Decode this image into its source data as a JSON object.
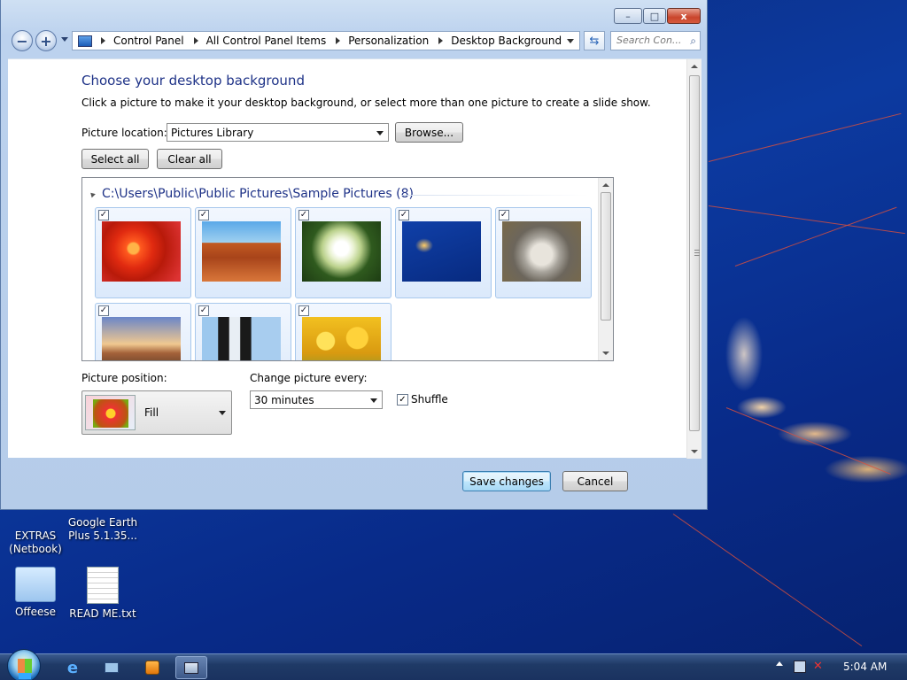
{
  "window": {
    "caption": {
      "minimize": "–",
      "maximize": "□",
      "close": "x"
    },
    "address": {
      "crumbs": [
        "Control Panel",
        "All Control Panel Items",
        "Personalization",
        "Desktop Background"
      ]
    },
    "search_placeholder": "Search Con...",
    "content": {
      "title": "Choose your desktop background",
      "subtitle": "Click a picture to make it your desktop background, or select more than one picture to create a slide show.",
      "picture_location_label": "Picture location:",
      "picture_location_value": "Pictures Library",
      "browse_label": "Browse...",
      "select_all_label": "Select all",
      "clear_all_label": "Clear all",
      "group_header": "C:\\Users\\Public\\Public Pictures\\Sample Pictures (8)",
      "pictures": [
        {
          "name": "chrysanthemum",
          "checked": true
        },
        {
          "name": "desert",
          "checked": true
        },
        {
          "name": "hydrangeas",
          "checked": true
        },
        {
          "name": "jellyfish",
          "checked": true
        },
        {
          "name": "koala",
          "checked": true
        },
        {
          "name": "lighthouse",
          "checked": true
        },
        {
          "name": "penguins",
          "checked": true
        },
        {
          "name": "tulips",
          "checked": true
        }
      ],
      "check_glyph": "✓",
      "picture_position_label": "Picture position:",
      "picture_position_value": "Fill",
      "change_every_label": "Change picture every:",
      "change_every_value": "30 minutes",
      "shuffle_label": "Shuffle",
      "shuffle_checked": true
    },
    "save_label": "Save changes",
    "cancel_label": "Cancel"
  },
  "desktop": {
    "icons": [
      {
        "label": "EXTRAS\n(Netbook)"
      },
      {
        "label": "Google Earth Plus 5.1.35..."
      },
      {
        "label": "Offeese"
      },
      {
        "label": "READ ME.txt"
      }
    ]
  },
  "taskbar": {
    "clock": "5:04 AM",
    "buttons": [
      "internet-explorer",
      "network-tool",
      "media-player",
      "control-panel"
    ]
  },
  "colors": {
    "title_blue": "#1e3287",
    "desktop_blue": "#0c3aa0"
  }
}
